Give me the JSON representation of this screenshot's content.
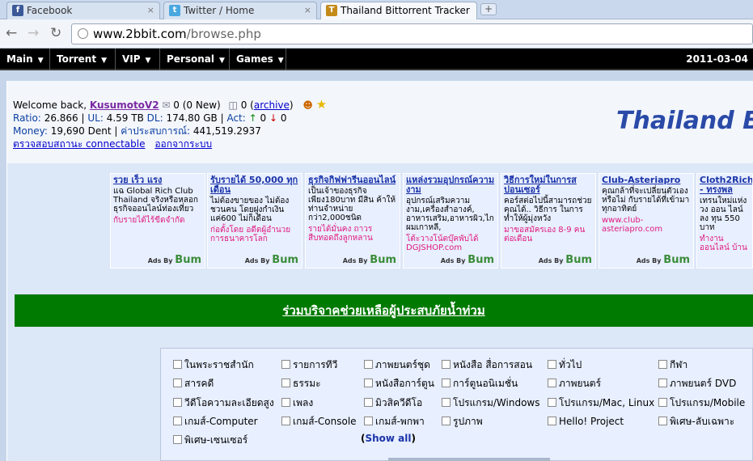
{
  "browser": {
    "tabs": [
      {
        "title": "Facebook",
        "icon": "facebook-icon",
        "active": false
      },
      {
        "title": "Twitter / Home",
        "icon": "twitter-icon",
        "active": false
      },
      {
        "title": "Thailand Bittorrent Tracker",
        "icon": "site-icon",
        "active": true
      }
    ],
    "new_tab": "+",
    "close_glyph": "×",
    "url_domain": "www.2bbit.com",
    "url_path": "/browse.php"
  },
  "site_nav": {
    "items": [
      "Main",
      "Torrent",
      "VIP",
      "Personal",
      "Games"
    ],
    "date": "2011-03-04"
  },
  "user": {
    "welcome": "Welcome back,",
    "username": "KusumotoV2",
    "messages": "0 (0 New)",
    "archive_count": "0",
    "archive_label": "archive",
    "ratio_label": "Ratio:",
    "ratio": "26.866",
    "ul_label": "UL:",
    "ul": "4.59 TB",
    "dl_label": "DL:",
    "dl": "174.80 GB",
    "act_label": "Act:",
    "act_up": "0",
    "act_down": "0",
    "money_label": "Money:",
    "money": "19,690 Dent",
    "exp_label": "ค่าประสบการณ์:",
    "exp": "441,519.2937",
    "check_connect": "ตรวจสอบสถานะ connectable",
    "logout": "ออกจากระบบ"
  },
  "logo_text": "Thailand Bi",
  "ads": [
    {
      "title": "รวย เร็ว แรง",
      "body": "แฉ Global Rich Club Thailand จริงหรือหลอก ธุรกิจออนไลน์ท่องเที่ยว",
      "url": "กับรายได้ไร้ขีดจำกัด"
    },
    {
      "title": "รับรายได้ 50,000 ทุกเดือน",
      "body": "ไม่ต้องขายของ ไม่ต้องชวนคน โดยฝูงกำเงิน แค่600 ไม่ก็เดือน",
      "url": "ก่อตั้งโดย อดีตผู้อำนวยการธนาคารโลก"
    },
    {
      "title": "ธุรกิจกิฟฟารีนออนไลน์",
      "body": "เป็นเจ้าของธุรกิจ เพียง180บาท มีสิน ค้าให้ท่านจำหน่าย กว่า2,000ชนิด",
      "url": "รายได้มั่นคง ถาวร สืบทอดถึงลูกหลาน"
    },
    {
      "title": "แหล่งรวมอุปกรณ์ความงาม",
      "body": "อุปกรณ์เสริมความงาม,เครื่องสำอางค์, อาหารเสริม,อาหารผิว,ไกผมเกาหลี,",
      "url": "โต้ะวางโน้ตบุ๊คพับได้ DGJSHOP.com"
    },
    {
      "title": "วิธีการใหม่ในการสปอนเซอร์",
      "body": "คอร์สต่อไปนี้สามารถช่วยคุณได้.. วิธีการ ในการทำให้ผู้มุ่งหวัง",
      "url": "มาขอสมัครเอง 8-9 คนต่อเดือน"
    },
    {
      "title": "Club-Asteriapro",
      "body": "คุณกล้าที่จะเปลี่ยนตัวเองหรือไม่ กับรายได้ที่เข้ามาทุกอาทิตย์",
      "url": "www.club-asteriapro.com"
    },
    {
      "title": "Cloth2Rich - ทรงพล",
      "body": "เทรนใหม่แห่งวง ออน ไลน์ ลง ทุน 550 บาท",
      "url": "ทำงานออนไลน์ บ้าน"
    }
  ],
  "ads_by": "Ads By",
  "ads_brand": "Bum",
  "donate": "ร่วมบริจาคช่วยเหลือผู้ประสบภัยน้ำท่วม",
  "categories": [
    [
      "ในพระราชสำนัก",
      "รายการทีวี",
      "ภาพยนตร์ชุด",
      "หนังสือ สื่อการสอน",
      "ทั่วไป",
      "กีฬา"
    ],
    [
      "สารคดี",
      "ธรรมะ",
      "หนังสือการ์ตูน",
      "การ์ตูนอนิเมชั่น",
      "ภาพยนตร์",
      "ภาพยนตร์ DVD"
    ],
    [
      "วีดีโอความละเอียดสูง",
      "เพลง",
      "มิวสิควีดีโอ",
      "โปรแกรม/Windows",
      "โปรแกรม/Mac, Linux",
      "โปรแกรม/Mobile"
    ],
    [
      "เกมส์-Computer",
      "เกมส์-Console",
      "เกมส์-พกพา",
      "รูปภาพ",
      "Hello! Project",
      "พิเศษ-ลับเฉพาะ"
    ],
    [
      "พิเศษ-เซนเซอร์"
    ]
  ],
  "show_all": "Show all",
  "colors": {
    "donate_bg": "#007a00",
    "nav_bg": "#000000",
    "panel": "#dce7f7",
    "logo": "#2a4aa8"
  }
}
